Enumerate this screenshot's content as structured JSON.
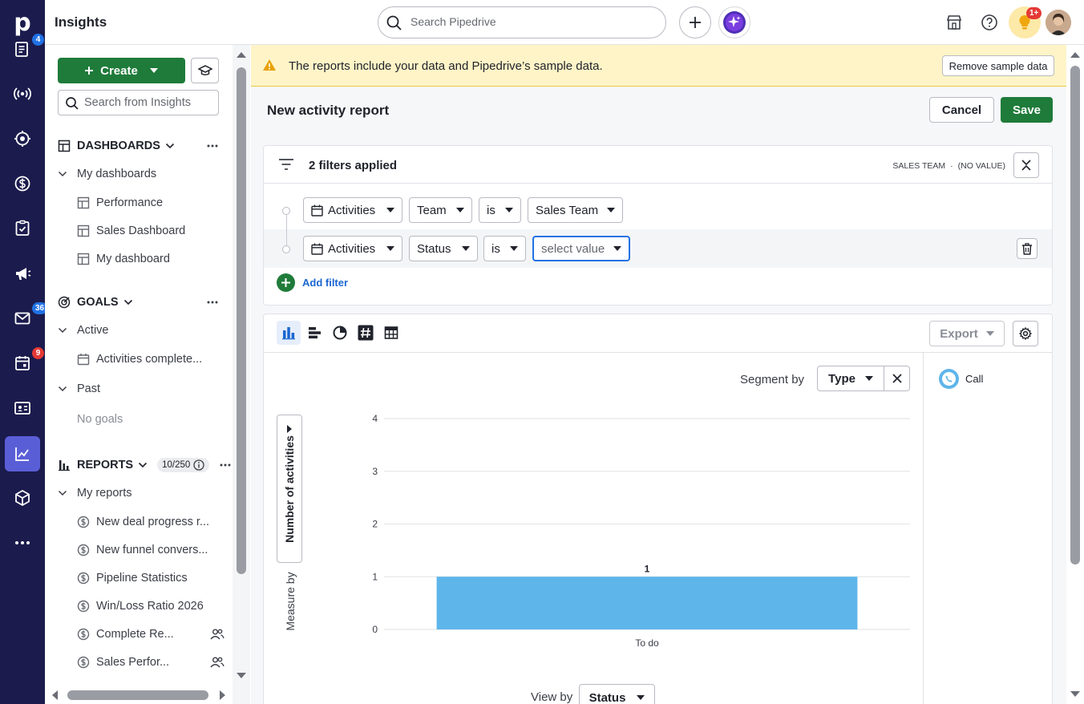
{
  "app": {
    "title": "Insights",
    "logo": "p"
  },
  "rail": {
    "items": [
      {
        "name": "leads-icon",
        "badge": "4",
        "badge_color": "#2172e5"
      },
      {
        "name": "campaign-signal-icon"
      },
      {
        "name": "target-icon"
      },
      {
        "name": "deals-dollar-icon"
      },
      {
        "name": "activities-icon"
      },
      {
        "name": "megaphone-icon"
      },
      {
        "name": "mail-icon",
        "badge": "36",
        "badge_color": "#2172e5"
      },
      {
        "name": "calendar-icon",
        "badge": "9",
        "badge_color": "#e53935"
      },
      {
        "name": "contacts-icon"
      },
      {
        "name": "insights-chart-icon",
        "active": true
      },
      {
        "name": "products-box-icon"
      },
      {
        "name": "more-icon"
      }
    ]
  },
  "topbar": {
    "search_placeholder": "Search Pipedrive",
    "notification_badge": "1+"
  },
  "sidebar": {
    "create_label": "Create",
    "search_placeholder": "Search from Insights",
    "dashboards": {
      "label": "DASHBOARDS",
      "group": "My dashboards",
      "items": [
        "Performance",
        "Sales Dashboard",
        "My dashboard"
      ]
    },
    "goals": {
      "label": "GOALS",
      "active_label": "Active",
      "active_items": [
        "Activities complete..."
      ],
      "past_label": "Past",
      "past_empty": "No goals"
    },
    "reports": {
      "label": "REPORTS",
      "count": "10/250",
      "group": "My reports",
      "items": [
        {
          "label": "New deal progress r...",
          "shared": false
        },
        {
          "label": "New funnel convers...",
          "shared": false
        },
        {
          "label": "Pipeline Statistics",
          "shared": false
        },
        {
          "label": "Win/Loss Ratio 2026",
          "shared": false
        },
        {
          "label": "Complete Re...",
          "shared": true
        },
        {
          "label": "Sales Perfor...",
          "shared": true
        }
      ]
    }
  },
  "banner": {
    "text": "The reports include your data and Pipedrive’s sample data.",
    "remove_label": "Remove sample data"
  },
  "report": {
    "title": "New activity report",
    "cancel_label": "Cancel",
    "save_label": "Save"
  },
  "filters": {
    "summary": "2 filters applied",
    "applied_tag": "SALES TEAM",
    "applied_sep": "·",
    "applied_value": "(NO VALUE)",
    "rows": [
      {
        "entity": "Activities",
        "field": "Team",
        "op": "is",
        "value": "Sales Team"
      },
      {
        "entity": "Activities",
        "field": "Status",
        "op": "is",
        "value": "select value"
      }
    ],
    "add_label": "Add filter"
  },
  "chart_toolbar": {
    "export_label": "Export"
  },
  "segment": {
    "label": "Segment by",
    "value": "Type"
  },
  "legend": {
    "items": [
      {
        "label": "Call",
        "color": "#5eb5ea"
      }
    ]
  },
  "measure": {
    "label": "Measure by",
    "value": "Number of activities"
  },
  "view_by": {
    "label": "View by",
    "value": "Status"
  },
  "chart_data": {
    "type": "bar",
    "categories": [
      "To do"
    ],
    "series": [
      {
        "name": "Call",
        "values": [
          1
        ],
        "color": "#5eb5ea"
      }
    ],
    "data_labels": [
      "1"
    ],
    "yticks": [
      "0",
      "1",
      "2",
      "3",
      "4"
    ],
    "ylim": [
      0,
      4
    ],
    "grid": true
  }
}
